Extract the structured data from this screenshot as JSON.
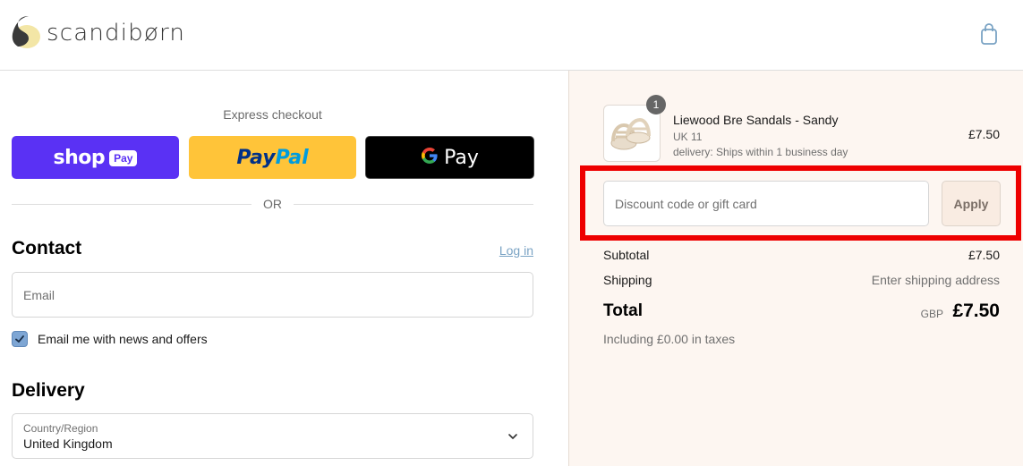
{
  "header": {
    "brand": "scandibørn",
    "cart_icon": "shopping-bag-icon"
  },
  "express": {
    "label": "Express checkout",
    "shop_pay": {
      "text": "shop",
      "badge": "Pay"
    },
    "paypal": {
      "part1": "Pay",
      "part2": "Pal"
    },
    "gpay": {
      "g": "G",
      "text": "Pay"
    },
    "or_text": "OR"
  },
  "contact": {
    "title": "Contact",
    "login_link": "Log in",
    "email_placeholder": "Email",
    "newsletter_label": "Email me with news and offers",
    "newsletter_checked": true
  },
  "delivery": {
    "title": "Delivery",
    "country_label": "Country/Region",
    "country_value": "United Kingdom"
  },
  "order": {
    "quantity": "1",
    "product_name": "Liewood Bre Sandals - Sandy",
    "variant": "UK 11",
    "delivery_note": "delivery: Ships within 1 business day",
    "price": "£7.50",
    "discount_placeholder": "Discount code or gift card",
    "apply_label": "Apply",
    "subtotal_label": "Subtotal",
    "subtotal_value": "£7.50",
    "shipping_label": "Shipping",
    "shipping_value": "Enter shipping address",
    "total_label": "Total",
    "total_currency": "GBP",
    "total_value": "£7.50",
    "tax_note": "Including £0.00 in taxes"
  },
  "colors": {
    "shop_pay": "#5a31f4",
    "paypal": "#ffc439",
    "gpay": "#000000",
    "highlight": "#ee0000",
    "summary_bg": "#fdf6f1"
  }
}
